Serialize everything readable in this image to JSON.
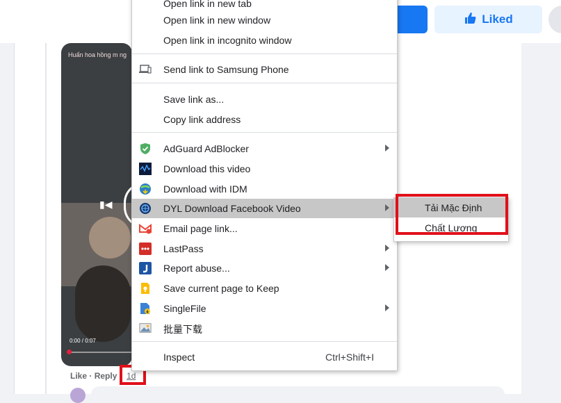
{
  "header": {
    "liked_label": "Liked"
  },
  "video": {
    "caption": "Huấn hoa hồng m ng",
    "time": "0:00 / 0:07"
  },
  "comment": {
    "like_label": "Like",
    "separator": "·",
    "reply_label": "Reply",
    "timestamp": "1d"
  },
  "context_menu": {
    "items": [
      {
        "label": "Open link in new tab"
      },
      {
        "label": "Open link in new window"
      },
      {
        "label": "Open link in incognito window"
      },
      {
        "label": "Send link to Samsung Phone",
        "icon": "device-icon"
      },
      {
        "label": "Save link as..."
      },
      {
        "label": "Copy link address"
      },
      {
        "label": "AdGuard AdBlocker",
        "icon": "adguard-shield-icon",
        "submenu": true
      },
      {
        "label": "Download this video",
        "icon": "video-download-icon"
      },
      {
        "label": "Download with IDM",
        "icon": "idm-globe-icon"
      },
      {
        "label": "DYL Download Facebook Video",
        "icon": "dyl-globe-icon",
        "submenu": true,
        "highlighted": true
      },
      {
        "label": "Email page link...",
        "icon": "gmail-icon"
      },
      {
        "label": "LastPass",
        "icon": "lastpass-icon",
        "submenu": true
      },
      {
        "label": "Report abuse...",
        "icon": "report-j-icon",
        "submenu": true
      },
      {
        "label": "Save current page to Keep",
        "icon": "keep-bulb-icon"
      },
      {
        "label": "SingleFile",
        "icon": "singlefile-icon",
        "submenu": true
      },
      {
        "label": "批量下载",
        "icon": "image-batch-icon"
      },
      {
        "label": "Inspect",
        "shortcut": "Ctrl+Shift+I"
      }
    ]
  },
  "submenu": {
    "items": [
      {
        "label": "Tải Mặc Định",
        "highlighted": true
      },
      {
        "label": "Chất Lượng"
      }
    ]
  },
  "colors": {
    "accent": "#1877f2",
    "highlight": "#e0101a"
  }
}
